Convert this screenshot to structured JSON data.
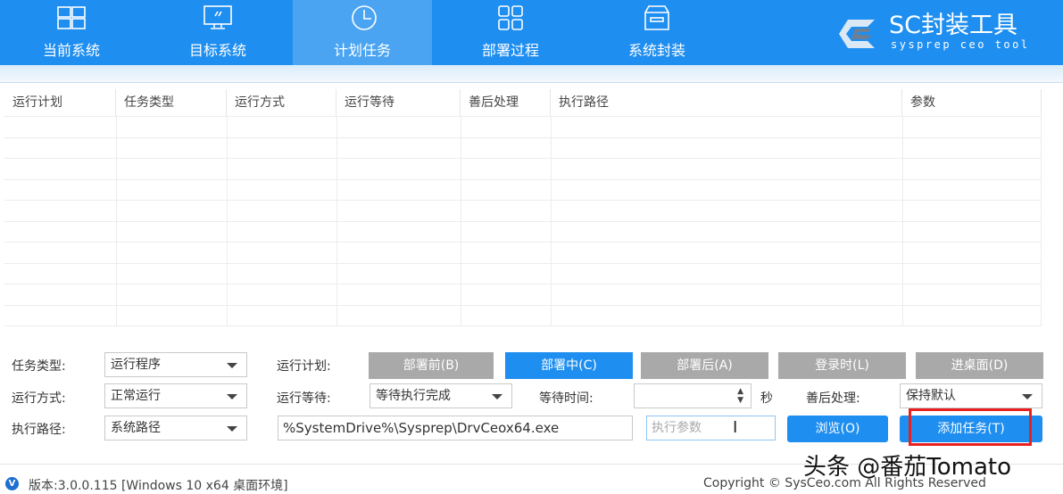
{
  "nav": {
    "tabs": [
      {
        "label": "当前系统",
        "icon": "windows-icon"
      },
      {
        "label": "目标系统",
        "icon": "monitor-icon"
      },
      {
        "label": "计划任务",
        "icon": "clock-icon",
        "active": true
      },
      {
        "label": "部署过程",
        "icon": "grid-icon"
      },
      {
        "label": "系统封装",
        "icon": "box-icon"
      }
    ],
    "logo": {
      "title": "SC封装工具",
      "subtitle": "sysprep ceo tool"
    }
  },
  "table": {
    "headers": [
      "运行计划",
      "任务类型",
      "运行方式",
      "运行等待",
      "善后处理",
      "执行路径",
      "参数"
    ],
    "rows": []
  },
  "form": {
    "task_type_label": "任务类型:",
    "task_type_value": "运行程序",
    "run_mode_label": "运行方式:",
    "run_mode_value": "正常运行",
    "exec_path_label": "执行路径:",
    "exec_path_value": "系统路径",
    "schedule_label": "运行计划:",
    "schedule_buttons": [
      "部署前(B)",
      "部署中(C)",
      "部署后(A)",
      "登录时(L)",
      "进桌面(D)"
    ],
    "schedule_selected": "部署中(C)",
    "wait_label": "运行等待:",
    "wait_value": "等待执行完成",
    "wait_time_label": "等待时间:",
    "wait_time_value": "",
    "seconds": "秒",
    "after_label": "善后处理:",
    "after_value": "保持默认",
    "path_value": "%SystemDrive%\\Sysprep\\DrvCeox64.exe",
    "params_placeholder": "执行参数",
    "browse": "浏览(O)",
    "add_task": "添加任务(T)"
  },
  "footer": {
    "version": "版本:3.0.0.115 [Windows 10 x64 桌面环境]",
    "copyright": "Copyright © SysCeo.com All Rights Reserved"
  },
  "watermark": "头条 @番茄Tomato",
  "colors": {
    "accent": "#1e8ef0",
    "highlight": "#e82020"
  }
}
